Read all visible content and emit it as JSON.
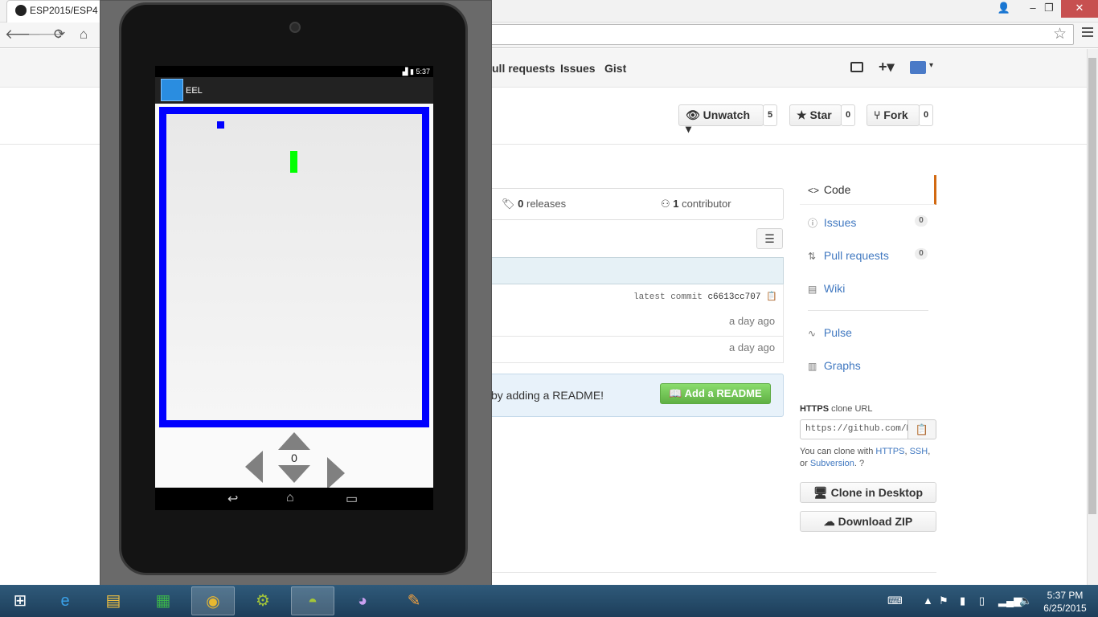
{
  "browser": {
    "tab_title": "ESP2015/ESP4",
    "nav": {
      "back": "🡐",
      "forward": "🡒",
      "reload": "⟳",
      "home": "⌂"
    },
    "star": "☆"
  },
  "github": {
    "nav": [
      "ull requests",
      "Issues",
      "Gist"
    ],
    "buttons": {
      "unwatch": "Unwatch",
      "unwatch_count": "5",
      "star": "Star",
      "star_count": "0",
      "fork": "Fork",
      "fork_count": "0"
    },
    "summary": {
      "releases_num": "0",
      "releases_label": "releases",
      "contributors_num": "1",
      "contributors_label": "contributor"
    },
    "latest_commit_label": "latest commit",
    "latest_commit_hash": "c6613cc707",
    "rows": [
      {
        "age": "a day ago"
      },
      {
        "age": "a day ago"
      }
    ],
    "readme_text": "by adding a README!",
    "add_readme": "Add a README",
    "sidebar": {
      "code": "Code",
      "issues": "Issues",
      "issues_count": "0",
      "pull_requests": "Pull requests",
      "pull_requests_count": "0",
      "wiki": "Wiki",
      "pulse": "Pulse",
      "graphs": "Graphs"
    },
    "clone": {
      "protocol": "HTTPS",
      "label": "clone URL",
      "url": "https://github.com/E",
      "help_prefix": "You can clone with",
      "https": "HTTPS",
      "ssh": "SSH",
      "or": "or",
      "subversion": "Subversion",
      "clone_desktop": "Clone in Desktop",
      "download_zip": "Download ZIP"
    }
  },
  "emulator": {
    "status_time": "5:37",
    "app_title": "EEL",
    "score": "0"
  },
  "taskbar": {
    "time": "5:37 PM",
    "date": "6/25/2015"
  },
  "colors": {
    "border_blue": "#0000ff",
    "eel_green": "#00ff00",
    "accent_green": "#60b044",
    "link": "#4078c0"
  }
}
